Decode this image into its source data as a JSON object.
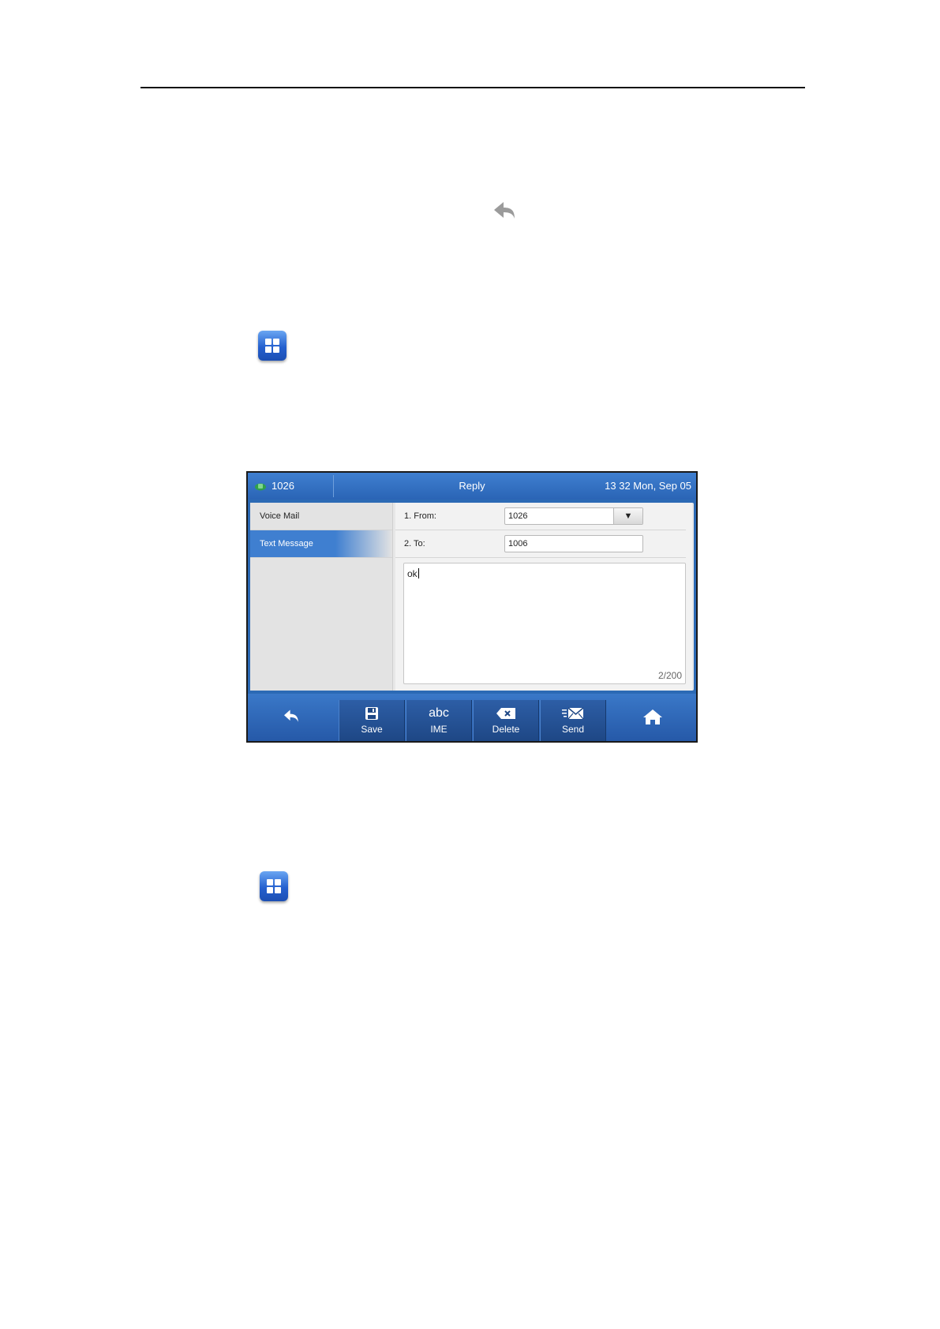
{
  "phone_screen": {
    "status_bar": {
      "account": "1026",
      "title": "Reply",
      "clock": "13 32 Mon, Sep 05"
    },
    "menu": [
      {
        "label": "Voice Mail",
        "active": false
      },
      {
        "label": "Text Message",
        "active": true
      }
    ],
    "form": {
      "from_label": "1. From:",
      "from_value": "1026",
      "to_label": "2. To:",
      "to_value": "1006",
      "message": "ok",
      "counter": "2/200"
    },
    "softkeys": {
      "save": "Save",
      "ime_glyph": "abc",
      "ime": "IME",
      "delete": "Delete",
      "send": "Send"
    }
  },
  "icons": {
    "inline_back": "back-icon",
    "menu_icon": "menu-icon",
    "dropdown": "dropdown-arrow-icon"
  },
  "colors": {
    "phone_blue": "#2c6ab5",
    "menu_icon_blue": "#2460cf",
    "active_item": "#3f7fd0"
  }
}
